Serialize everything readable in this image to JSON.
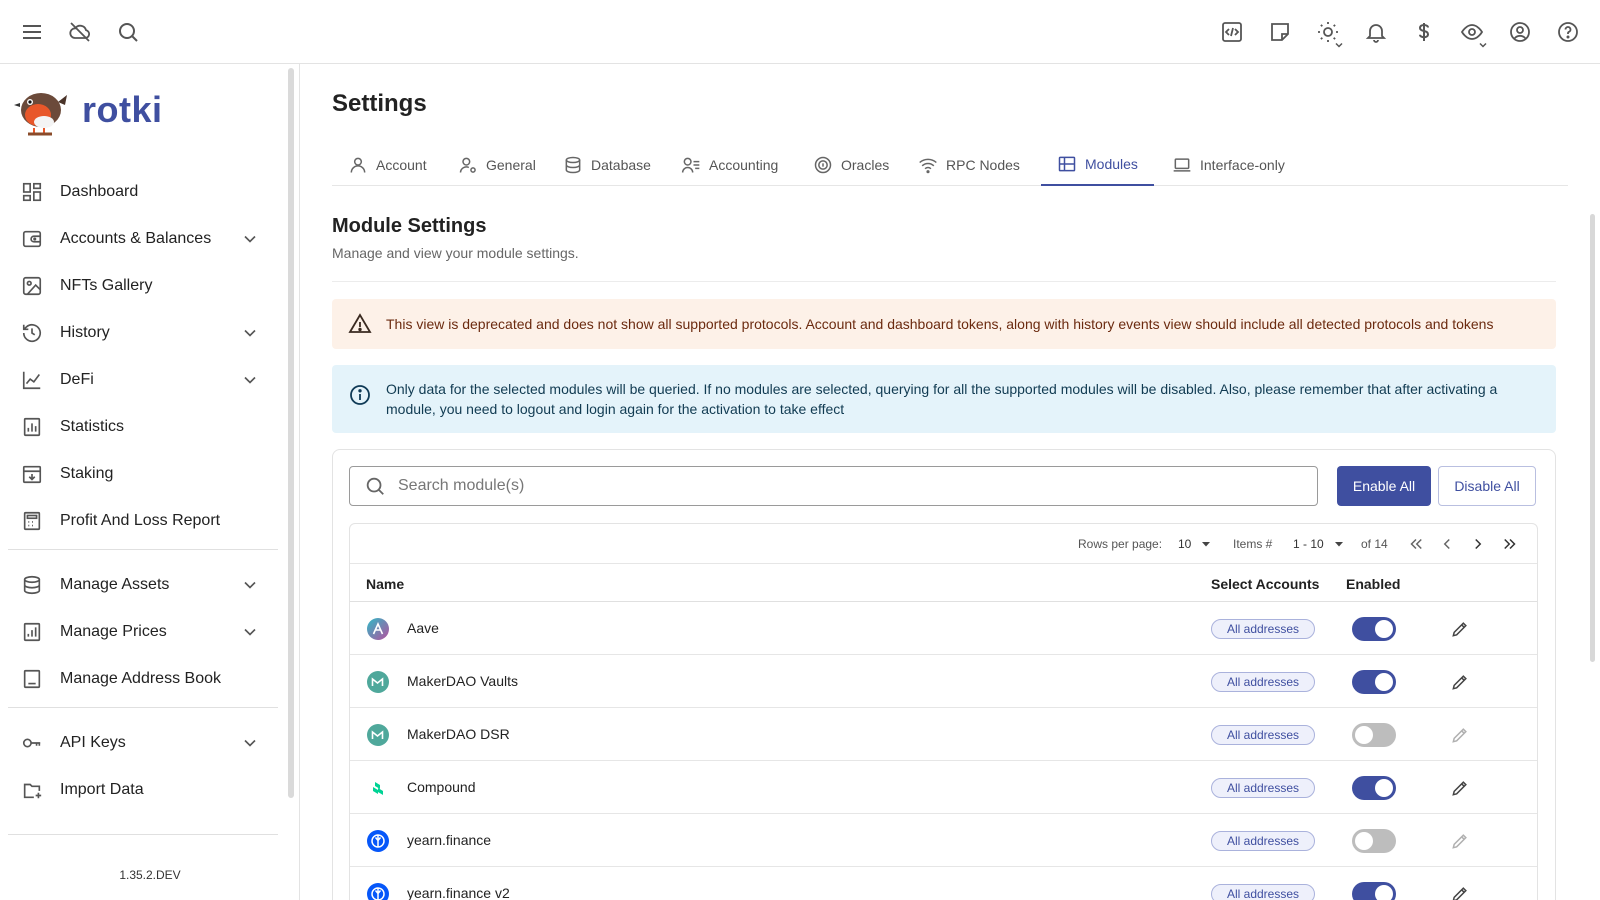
{
  "topbar": {
    "icons": [
      "menu-icon",
      "cloud-off-icon",
      "search-icon",
      "code-icon",
      "note-icon",
      "sun-icon",
      "bell-icon",
      "dollar-icon",
      "eye-icon",
      "account-icon",
      "help-icon"
    ]
  },
  "sidebar": {
    "app_name": "rotki",
    "items": [
      {
        "label": "Dashboard",
        "icon": "dashboard-icon"
      },
      {
        "label": "Accounts & Balances",
        "icon": "wallet-icon",
        "expandable": true
      },
      {
        "label": "NFTs Gallery",
        "icon": "image-icon"
      },
      {
        "label": "History",
        "icon": "history-icon",
        "expandable": true
      },
      {
        "label": "DeFi",
        "icon": "line-chart-icon",
        "expandable": true
      },
      {
        "label": "Statistics",
        "icon": "bar-chart-icon"
      },
      {
        "label": "Staking",
        "icon": "staking-icon"
      },
      {
        "label": "Profit And Loss Report",
        "icon": "calculator-icon"
      },
      {
        "label": "Manage Assets",
        "icon": "database-icon",
        "expandable": true
      },
      {
        "label": "Manage Prices",
        "icon": "price-chart-icon",
        "expandable": true
      },
      {
        "label": "Manage Address Book",
        "icon": "address-book-icon"
      },
      {
        "label": "API Keys",
        "icon": "key-icon",
        "expandable": true
      },
      {
        "label": "Import Data",
        "icon": "import-icon"
      }
    ],
    "version": "1.35.2.DEV"
  },
  "page": {
    "title": "Settings",
    "tabs": [
      {
        "label": "Account",
        "icon": "user-icon"
      },
      {
        "label": "General",
        "icon": "user-settings-icon"
      },
      {
        "label": "Database",
        "icon": "database-icon"
      },
      {
        "label": "Accounting",
        "icon": "accounting-icon"
      },
      {
        "label": "Oracles",
        "icon": "oracle-icon"
      },
      {
        "label": "RPC Nodes",
        "icon": "wifi-icon"
      },
      {
        "label": "Modules",
        "icon": "grid-icon",
        "active": true
      },
      {
        "label": "Interface-only",
        "icon": "laptop-icon"
      }
    ]
  },
  "module_settings": {
    "title": "Module Settings",
    "subtitle": "Manage and view your module settings.",
    "warning": "This view is deprecated and does not show all supported protocols. Account and dashboard tokens, along with history events view should include all detected protocols and tokens",
    "info": "Only data for the selected modules will be queried. If no modules are selected, querying for all the supported modules will be disabled. Also, please remember that after activating a module, you need to logout and login again for the activation to take effect",
    "search_placeholder": "Search module(s)",
    "enable_all": "Enable All",
    "disable_all": "Disable All"
  },
  "pagination": {
    "rows_per_page_label": "Rows per page:",
    "rows_per_page": "10",
    "items_label": "Items #",
    "range": "1 - 10",
    "of_total": "of 14"
  },
  "table": {
    "headers": {
      "name": "Name",
      "accounts": "Select Accounts",
      "enabled": "Enabled"
    },
    "rows": [
      {
        "name": "Aave",
        "accounts": "All addresses",
        "enabled": true,
        "icon": "aave-icon",
        "color": "#b6509e"
      },
      {
        "name": "MakerDAO Vaults",
        "accounts": "All addresses",
        "enabled": true,
        "icon": "makerdao-icon",
        "color": "#4fa89b"
      },
      {
        "name": "MakerDAO DSR",
        "accounts": "All addresses",
        "enabled": false,
        "icon": "makerdao-icon",
        "color": "#4fa89b"
      },
      {
        "name": "Compound",
        "accounts": "All addresses",
        "enabled": true,
        "icon": "compound-icon",
        "color": "#00d395"
      },
      {
        "name": "yearn.finance",
        "accounts": "All addresses",
        "enabled": false,
        "icon": "yearn-icon",
        "color": "#0657f9"
      },
      {
        "name": "yearn.finance v2",
        "accounts": "All addresses",
        "enabled": true,
        "icon": "yearn-icon",
        "color": "#0657f9"
      }
    ]
  },
  "colors": {
    "accent": "#3f4fa0",
    "warning_bg": "#fdf1e8",
    "info_bg": "#e4f3fa"
  }
}
